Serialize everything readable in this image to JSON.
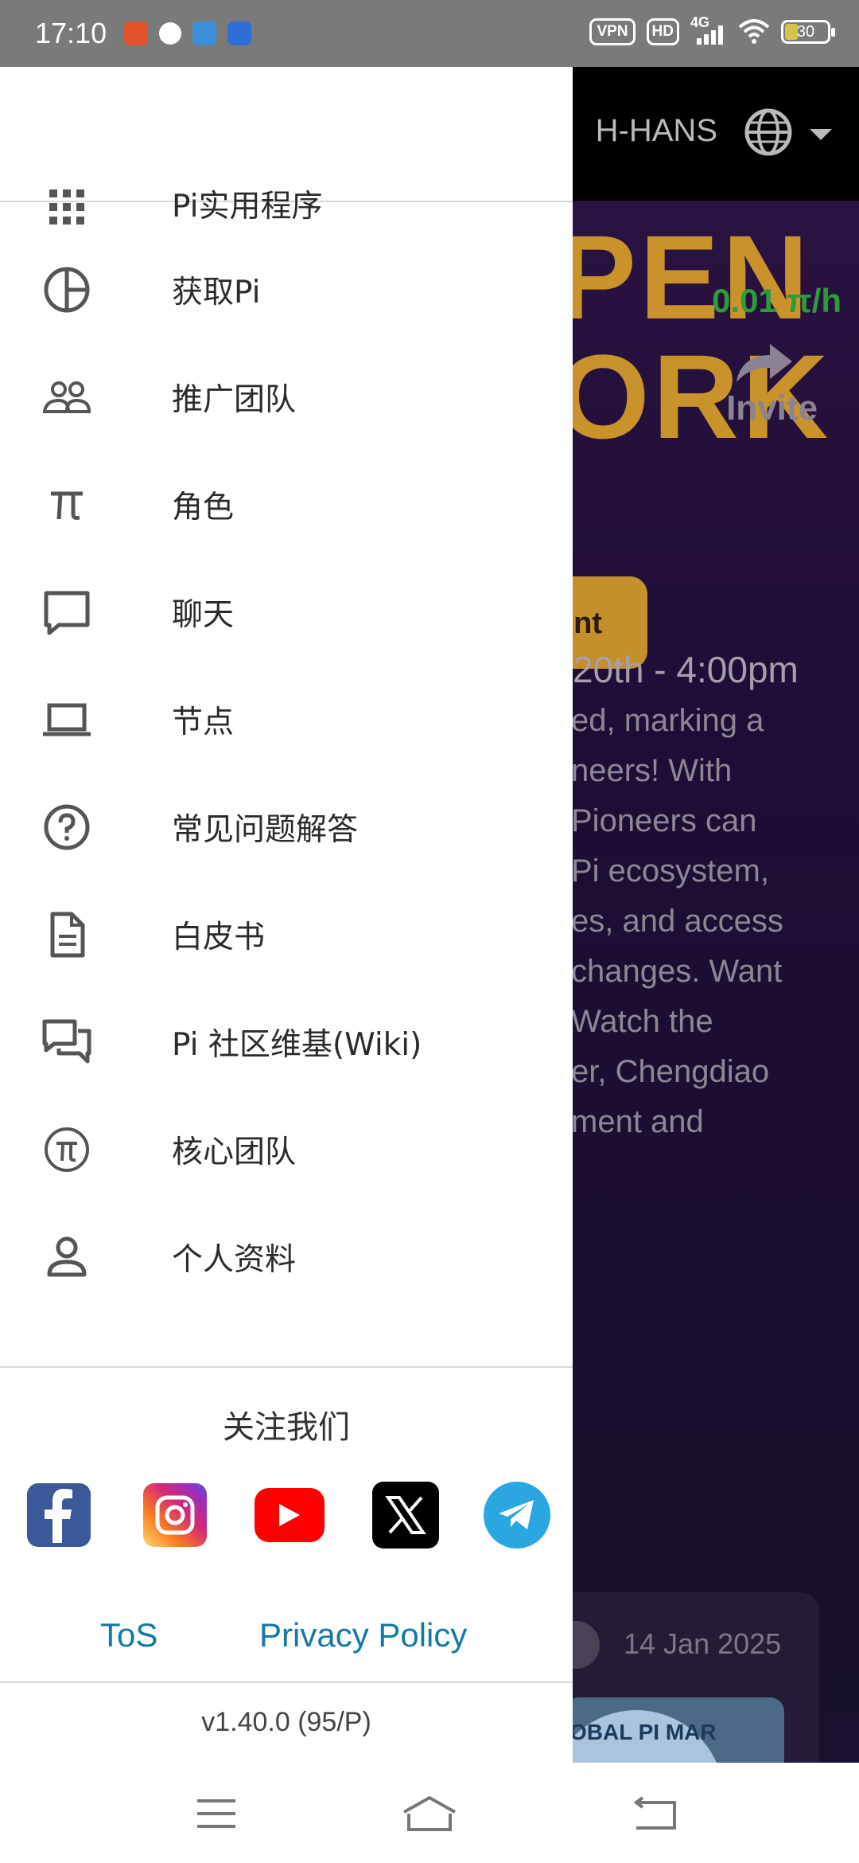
{
  "status_bar": {
    "time": "17:10",
    "vpn": "VPN",
    "hd": "HD",
    "network": "4G",
    "battery": "30",
    "battery_level": 0.3
  },
  "background": {
    "language": "H-HANS",
    "hero_word_1": "PEN",
    "hero_word_2": "ORK",
    "mining_rate": "0.01 π/h",
    "invite_label": "Invite",
    "button_label": "ent",
    "event_time": "20th - 4:00pm",
    "paragraph_lines": [
      "ed, marking a",
      "neers! With",
      "Pioneers can",
      "Pi ecosystem,",
      "es, and access",
      "changes. Want",
      "Watch the",
      "er, Chengdiao",
      "ment and"
    ],
    "card_date": "14 Jan 2025",
    "card_image_text": "OBAL PI MAR"
  },
  "drawer": {
    "menu": [
      {
        "label": "Pi实用程序",
        "icon": "apps-grid-icon"
      },
      {
        "label": "获取Pi",
        "icon": "pie-chart-icon"
      },
      {
        "label": "推广团队",
        "icon": "team-icon"
      },
      {
        "label": "角色",
        "icon": "pi-symbol-icon"
      },
      {
        "label": "聊天",
        "icon": "chat-icon"
      },
      {
        "label": "节点",
        "icon": "laptop-icon"
      },
      {
        "label": "常见问题解答",
        "icon": "help-circle-icon"
      },
      {
        "label": "白皮书",
        "icon": "document-icon"
      },
      {
        "label": "Pi 社区维基(Wiki)",
        "icon": "forum-icon"
      },
      {
        "label": "核心团队",
        "icon": "pi-circle-icon"
      },
      {
        "label": "个人资料",
        "icon": "person-icon"
      }
    ],
    "follow_title": "关注我们",
    "socials": [
      {
        "name": "facebook",
        "color": "#3b5998"
      },
      {
        "name": "instagram",
        "color": "#e1306c"
      },
      {
        "name": "youtube",
        "color": "#ff0000"
      },
      {
        "name": "x",
        "color": "#000000"
      },
      {
        "name": "telegram",
        "color": "#2aa6e0"
      }
    ],
    "tos_label": "ToS",
    "privacy_label": "Privacy Policy",
    "version": "v1.40.0 (95/P)"
  },
  "colors": {
    "link": "#1479a8",
    "accent_gold": "#c9922a",
    "rate_green": "#2d9b3a"
  }
}
